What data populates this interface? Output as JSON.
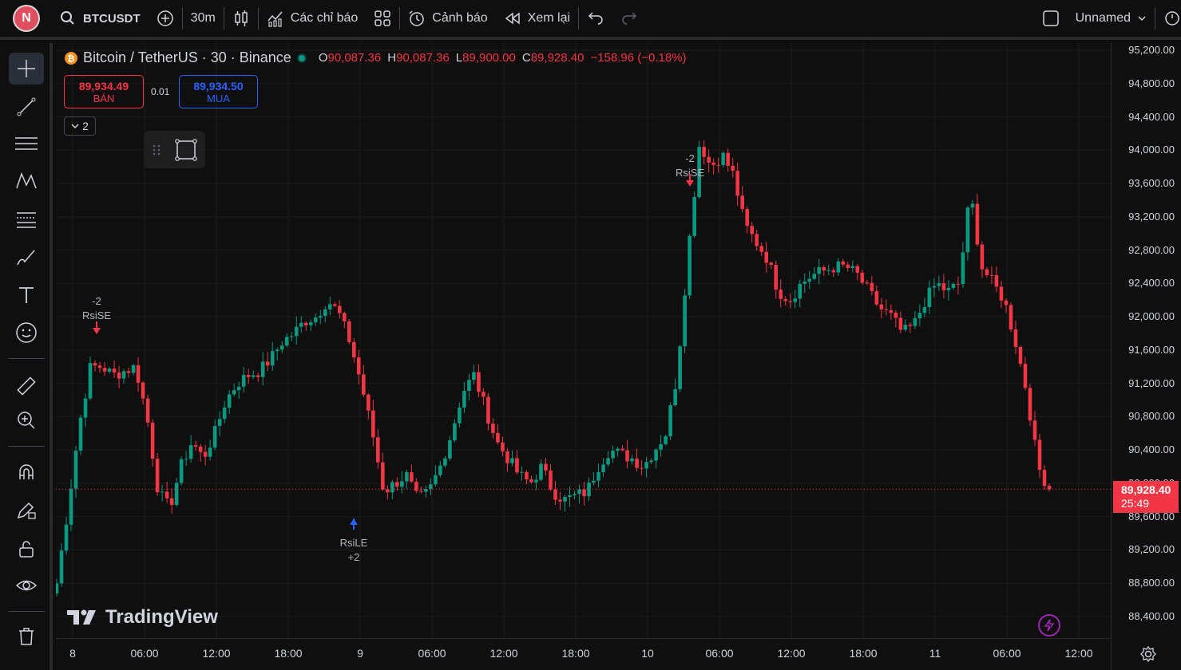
{
  "topbar": {
    "avatar_letter": "N",
    "symbol": "BTCUSDT",
    "interval": "30m",
    "indicators_label": "Các chỉ báo",
    "alerts_label": "Cảnh báo",
    "replay_label": "Xem lại",
    "layout_name": "Unnamed"
  },
  "legend": {
    "title": "Bitcoin / TetherUS · 30 · Binance",
    "o_key": "O",
    "o_val": "90,087.36",
    "h_key": "H",
    "h_val": "90,087.36",
    "l_key": "L",
    "l_val": "89,900.00",
    "c_key": "C",
    "c_val": "89,928.40",
    "change": "−158.96 (−0.18%)"
  },
  "trade": {
    "sell_price": "89,934.49",
    "sell_label": "BÁN",
    "spread": "0.01",
    "buy_price": "89,934.50",
    "buy_label": "MUA",
    "collapse_count": "2"
  },
  "watermark": "TradingView",
  "current_price": {
    "price": "89,928.40",
    "countdown": "25:49"
  },
  "colors": {
    "up": "#089981",
    "down": "#f23645",
    "buy": "#2962ff",
    "bg": "#0f0f0f"
  },
  "chart_data": {
    "type": "candlestick",
    "symbol": "BTCUSDT",
    "interval": "30",
    "y_ticks": [
      95200,
      94800,
      94400,
      94000,
      93600,
      93200,
      92800,
      92400,
      92000,
      91600,
      91200,
      90800,
      90400,
      90000,
      89600,
      89200,
      88800,
      88400
    ],
    "y_tick_labels": [
      "95,200.00",
      "94,800.00",
      "94,400.00",
      "94,000.00",
      "93,600.00",
      "93,200.00",
      "92,800.00",
      "92,400.00",
      "92,000.00",
      "91,600.00",
      "91,200.00",
      "90,800.00",
      "90,400.00",
      "90,000.00",
      "89,600.00",
      "89,200.00",
      "88,800.00",
      "88,400.00"
    ],
    "x_ticks": [
      "8",
      "06:00",
      "12:00",
      "18:00",
      "9",
      "06:00",
      "12:00",
      "18:00",
      "10",
      "06:00",
      "12:00",
      "18:00",
      "11",
      "06:00",
      "12:00"
    ],
    "ylim": [
      88250,
      95300
    ],
    "close_path": [
      88800,
      89700,
      90700,
      91400,
      91400,
      91300,
      91350,
      91400,
      90800,
      89900,
      89700,
      90200,
      90500,
      90300,
      90600,
      91000,
      91200,
      91300,
      91350,
      91500,
      91700,
      91800,
      91950,
      92000,
      92200,
      92050,
      91700,
      91200,
      90600,
      89900,
      90000,
      90100,
      89800,
      89900,
      90200,
      90600,
      91100,
      91300,
      90900,
      90500,
      90300,
      90100,
      90000,
      90200,
      89900,
      89800,
      89850,
      89900,
      90200,
      90400,
      90350,
      90300,
      90200,
      90400,
      90600,
      91300,
      92800,
      94100,
      93800,
      93950,
      93700,
      93100,
      92900,
      92700,
      92300,
      92200,
      92400,
      92500,
      92550,
      92600,
      92600,
      92500,
      92300,
      92100,
      92000,
      91800,
      91900,
      92200,
      92400,
      92300,
      92400,
      93500,
      92600,
      92400,
      92200,
      91700,
      91100,
      90200,
      89928
    ],
    "signals": [
      {
        "label": "RsiSE",
        "qty": "-2",
        "direction": "sell"
      },
      {
        "label": "RsiLE",
        "qty": "+2",
        "direction": "buy"
      },
      {
        "label": "RsiSE",
        "qty": "-2",
        "direction": "sell"
      }
    ]
  }
}
